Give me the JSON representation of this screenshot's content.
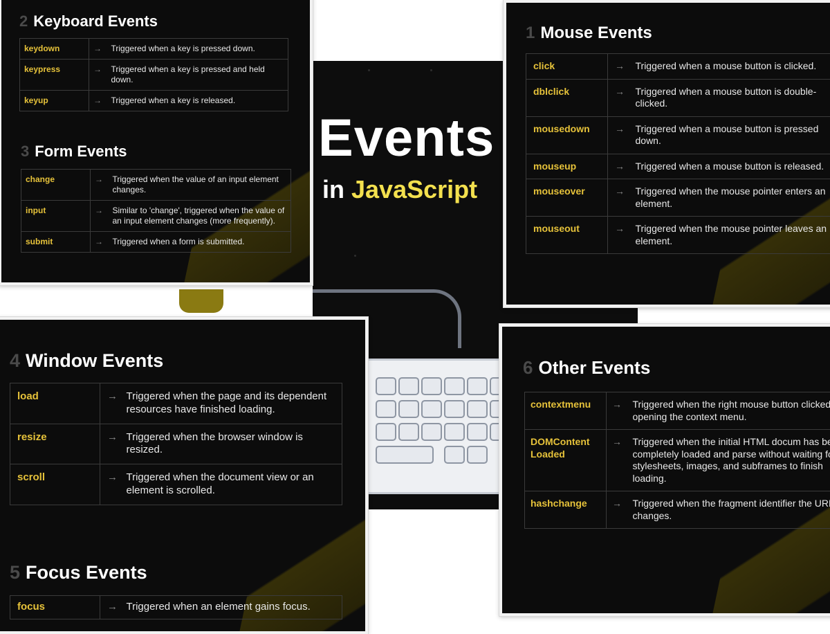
{
  "poster": {
    "title": "Events",
    "sub_prefix": "in ",
    "sub_js": "JavaScript"
  },
  "keyboard": {
    "num": "2",
    "title": "Keyboard Events",
    "rows": [
      {
        "name": "keydown",
        "desc": "Triggered when a key is pressed down."
      },
      {
        "name": "keypress",
        "desc": "Triggered when a key is pressed and held down."
      },
      {
        "name": "keyup",
        "desc": "Triggered when a key is released."
      }
    ]
  },
  "form": {
    "num": "3",
    "title": "Form Events",
    "rows": [
      {
        "name": "change",
        "desc": "Triggered when the value of an input element changes."
      },
      {
        "name": "input",
        "desc": "Similar to 'change', triggered when the value of an input element changes (more frequently)."
      },
      {
        "name": "submit",
        "desc": "Triggered when a form is submitted."
      }
    ]
  },
  "mouse": {
    "num": "1",
    "title": "Mouse Events",
    "rows": [
      {
        "name": "click",
        "desc": "Triggered when a mouse button is clicked."
      },
      {
        "name": "dblclick",
        "desc": "Triggered when a mouse button is double-clicked."
      },
      {
        "name": "mousedown",
        "desc": "Triggered when a mouse button is pressed down."
      },
      {
        "name": "mouseup",
        "desc": "Triggered when a mouse button is released."
      },
      {
        "name": "mouseover",
        "desc": "Triggered when the mouse pointer enters an element."
      },
      {
        "name": "mouseout",
        "desc": "Triggered when the mouse pointer leaves an element."
      }
    ]
  },
  "window": {
    "num": "4",
    "title": "Window Events",
    "rows": [
      {
        "name": "load",
        "desc": "Triggered when the page and its dependent resources have finished loading."
      },
      {
        "name": "resize",
        "desc": "Triggered when the browser window is resized."
      },
      {
        "name": "scroll",
        "desc": "Triggered when the document view or an element is scrolled."
      }
    ]
  },
  "focus": {
    "num": "5",
    "title": "Focus Events",
    "rows": [
      {
        "name": "focus",
        "desc": "Triggered when an element gains focus."
      }
    ]
  },
  "other": {
    "num": "6",
    "title": "Other Events",
    "rows": [
      {
        "name": "contextmenu",
        "desc": "Triggered when the right mouse button clicked, opening the context menu."
      },
      {
        "name": "DOMContent Loaded",
        "desc": "Triggered when the initial HTML docum has been completely loaded and parse without waiting for stylesheets, images, and subframes to finish loading."
      },
      {
        "name": "hashchange",
        "desc": "Triggered when the fragment identifier the URL changes."
      }
    ]
  },
  "arrow": "→"
}
